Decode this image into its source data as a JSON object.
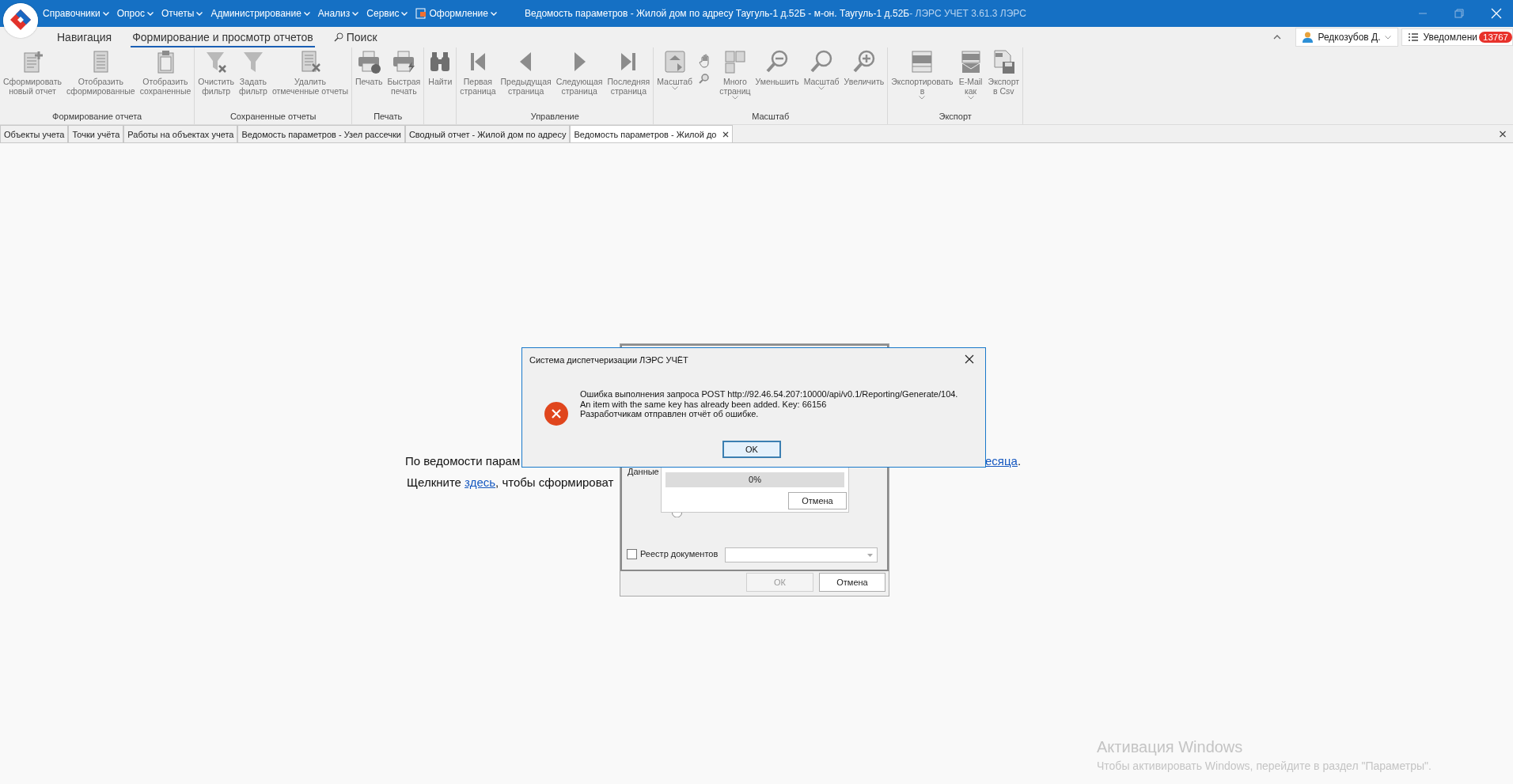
{
  "title_bar": {
    "menu": [
      {
        "label": "Справочники",
        "kind": "menu"
      },
      {
        "label": "Опрос",
        "kind": "menu"
      },
      {
        "label": "Отчеты",
        "kind": "menu"
      },
      {
        "label": "Администрирование",
        "kind": "menu"
      },
      {
        "label": "Анализ",
        "kind": "menu"
      },
      {
        "label": "Сервис",
        "kind": "menu"
      },
      {
        "label": "Оформление",
        "kind": "theme"
      }
    ],
    "title": "Ведомость параметров - Жилой дом по адресу  Таугуль-1 д.52Б - м-он. Таугуль-1 д.52Б",
    "app_name": " - ЛЭРС УЧЕТ 3.61.3 ЛЭРС"
  },
  "ribbon_tabs": [
    {
      "label": "Навигация",
      "selected": false,
      "kind": "tab"
    },
    {
      "label": "Формирование и просмотр отчетов",
      "selected": true,
      "kind": "tab"
    },
    {
      "label": "Поиск",
      "selected": false,
      "kind": "search"
    }
  ],
  "user": "Редкозубов Д.",
  "notifications": {
    "label": "Уведомлени",
    "count": "13767"
  },
  "ribbon_groups": [
    {
      "label": "Формирование отчета",
      "buttons": [
        {
          "kind": "newdoc",
          "label": "Сформировать\nновый отчет"
        },
        {
          "kind": "listdoc",
          "label": "Отобразить\nсформированные"
        },
        {
          "kind": "clipboard",
          "label": "Отобразить\nсохраненные"
        }
      ]
    },
    {
      "label": "Сохраненные отчеты",
      "buttons": [
        {
          "kind": "filterx",
          "label": "Очистить\nфильтр"
        },
        {
          "kind": "filter",
          "label": "Задать\nфильтр"
        },
        {
          "kind": "deldoc",
          "label": "Удалить\nотмеченные отчеты"
        }
      ]
    },
    {
      "label": "Печать",
      "buttons": [
        {
          "kind": "print",
          "label": "Печать"
        },
        {
          "kind": "quickprint",
          "label": "Быстрая\nпечать"
        }
      ]
    },
    {
      "buttons": [
        {
          "kind": "find",
          "label": "Найти"
        }
      ]
    },
    {
      "label": "Управление",
      "buttons": [
        {
          "kind": "first",
          "label": "Первая\nстраница"
        },
        {
          "kind": "prev",
          "label": "Предыдущая\nстраница"
        },
        {
          "kind": "next",
          "label": "Следующая\nстраница"
        },
        {
          "kind": "last",
          "label": "Последняя\nстраница"
        }
      ]
    },
    {
      "label": "Масштаб",
      "buttons": [
        {
          "kind": "zoompage",
          "label": "Масштаб",
          "dropdown": true
        },
        {
          "kind": "handzoom"
        },
        {
          "kind": "pages",
          "label": "Много\nстраниц",
          "dropdown": true
        },
        {
          "kind": "zoomout",
          "label": "Уменьшить"
        },
        {
          "kind": "zoom",
          "label": "Масштаб",
          "dropdown": true
        },
        {
          "kind": "zoomin",
          "label": "Увеличить"
        }
      ]
    },
    {
      "label": "Экспорт",
      "buttons": [
        {
          "kind": "pdf",
          "label": "Экспортировать\nв",
          "dropdown": true
        },
        {
          "kind": "mail",
          "label": "E-Mail\nкак",
          "dropdown": true
        },
        {
          "kind": "csv",
          "label": "Экспорт\nв Csv"
        }
      ]
    }
  ],
  "document_tabs": [
    {
      "label": "Объекты учета",
      "selected": false
    },
    {
      "label": "Точки учёта",
      "selected": false
    },
    {
      "label": "Работы на объектах учета",
      "selected": false
    },
    {
      "label": "Ведомость параметров - Узел рассечки",
      "selected": false
    },
    {
      "label": "Сводный отчет - Жилой дом по адресу",
      "selected": false
    },
    {
      "label": "Ведомость параметров - Жилой до",
      "selected": true
    }
  ],
  "report_message": {
    "line_1_start": "По ведомости парам",
    "line_1_end_link": "есяца",
    "line_1_end": ".",
    "line_2_before": "Щелкните ",
    "line_2_link": "здесь",
    "line_2_after": ", чтобы сформироват"
  },
  "progress_dialog": {
    "data_label": "Данные",
    "progress": {
      "level": 0,
      "reading": "0%"
    },
    "cancel": "Отмена",
    "radio": {
      "selected": false
    },
    "checkbox": {
      "label": "Реестр документов",
      "checked": false
    },
    "buttons": [
      {
        "label": "ОК",
        "disabled": true
      },
      {
        "label": "Отмена",
        "disabled": false
      }
    ]
  },
  "error_dialog": {
    "title": "Система диспетчеризации ЛЭРС УЧЁТ",
    "message": "Ошибка выполнения запроса POST http://92.46.54.207:10000/api/v0.1/Reporting/Generate/104.\nAn item with the same key has already been added. Key: 66156\nРазработчикам отправлен отчёт об ошибке.",
    "button": "OK"
  },
  "os_notice": {
    "title": "Активация Windows",
    "text": "Чтобы активировать Windows, перейдите в раздел \"Параметры\"."
  }
}
